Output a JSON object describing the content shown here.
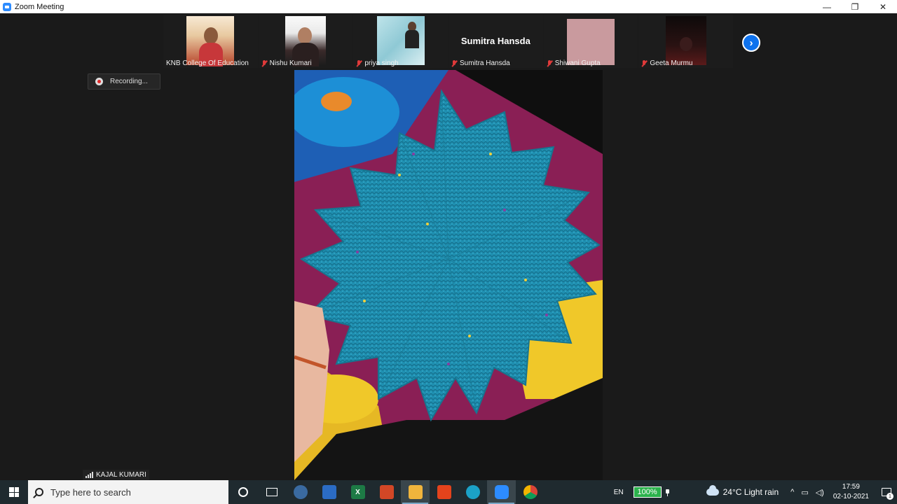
{
  "window": {
    "title": "Zoom Meeting",
    "controls": {
      "minimize": "—",
      "maximize": "❐",
      "close": "✕"
    }
  },
  "thumbnails": [
    {
      "name": "KNB College Of Education",
      "muted": false,
      "video": true
    },
    {
      "name": "Nishu Kumari",
      "muted": true,
      "video": true
    },
    {
      "name": "priya singh",
      "muted": true,
      "video": true
    },
    {
      "name": "Sumitra Hansda",
      "muted": true,
      "video": false,
      "display_name": "Sumitra Hansda"
    },
    {
      "name": "Shiwani Gupta",
      "muted": true,
      "video": true
    },
    {
      "name": "Geeta Murmu",
      "muted": true,
      "video": true
    }
  ],
  "next_page": "›",
  "recording": {
    "label": "Recording..."
  },
  "active_speaker": {
    "name": "KAJAL KUMARI"
  },
  "taskbar": {
    "search_placeholder": "Type here to search",
    "apps": [
      "file-explorer-old",
      "store",
      "excel",
      "office-lens",
      "file-explorer",
      "office",
      "edge",
      "zoom",
      "chrome"
    ],
    "language": "EN",
    "battery": "100%",
    "weather": "24°C  Light rain",
    "time": "17:59",
    "date": "02-10-2021",
    "notifications": "1",
    "tray_chevron": "^"
  },
  "colors": {
    "accent": "#0e72ed",
    "muted_mic": "#e03a3a",
    "battery": "#2bb24c"
  }
}
